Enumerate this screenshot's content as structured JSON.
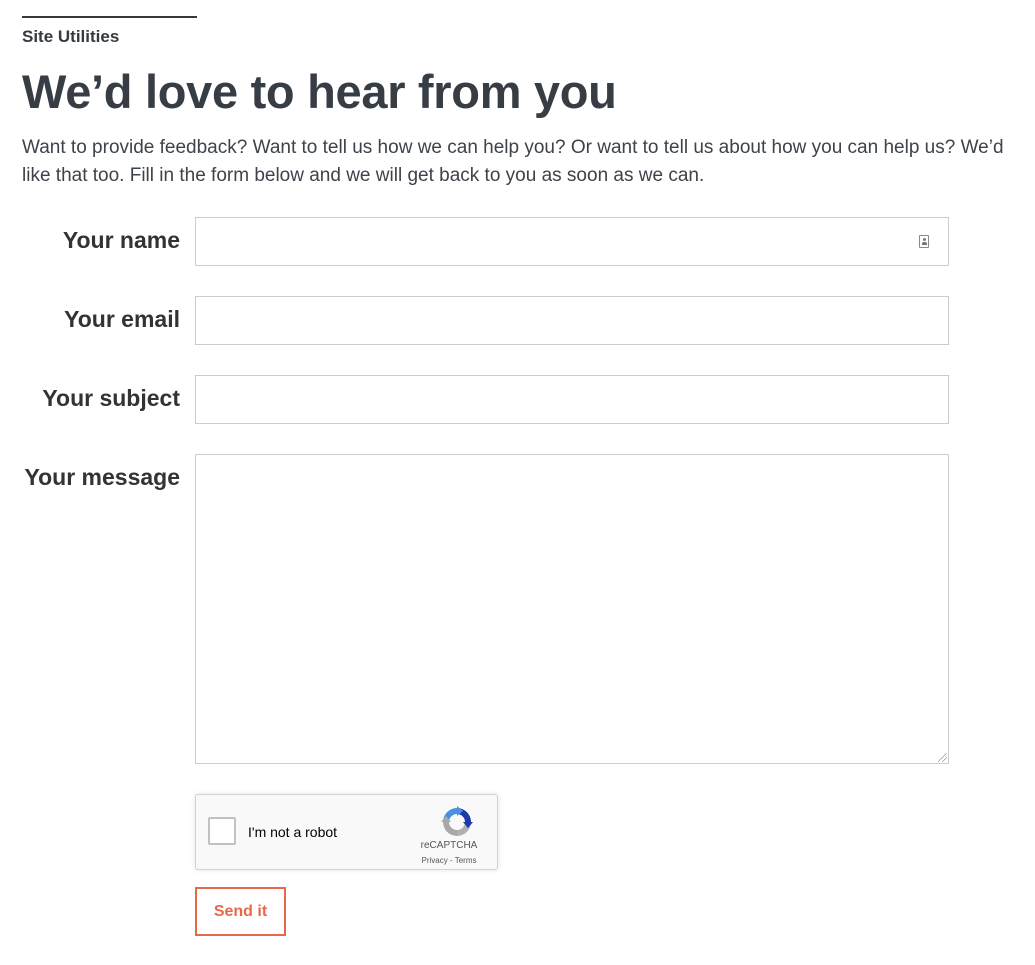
{
  "header": {
    "eyebrow": "Site Utilities",
    "title": "We’d love to hear from you",
    "intro": "Want to provide feedback? Want to tell us how we can help you? Or want to tell us about how you can help us? We’d like that too. Fill in the form below and we will get back to you as soon as we can."
  },
  "form": {
    "name_label": "Your name",
    "name_value": "",
    "name_icon": "contact-card-icon",
    "email_label": "Your email",
    "email_value": "",
    "subject_label": "Your subject",
    "subject_value": "",
    "message_label": "Your message",
    "message_value": "",
    "submit_label": "Send it"
  },
  "recaptcha": {
    "checkbox_label": "I'm not a robot",
    "checked": false,
    "brand": "reCAPTCHA",
    "privacy_label": "Privacy",
    "separator": " - ",
    "terms_label": "Terms"
  },
  "colors": {
    "text": "#343a40",
    "accent": "#e8694a",
    "field_border": "#cccccc",
    "recaptcha_blue": "#1c3aa9",
    "recaptcha_light_blue": "#4a90e2",
    "recaptcha_gray": "#b0b0b0"
  }
}
